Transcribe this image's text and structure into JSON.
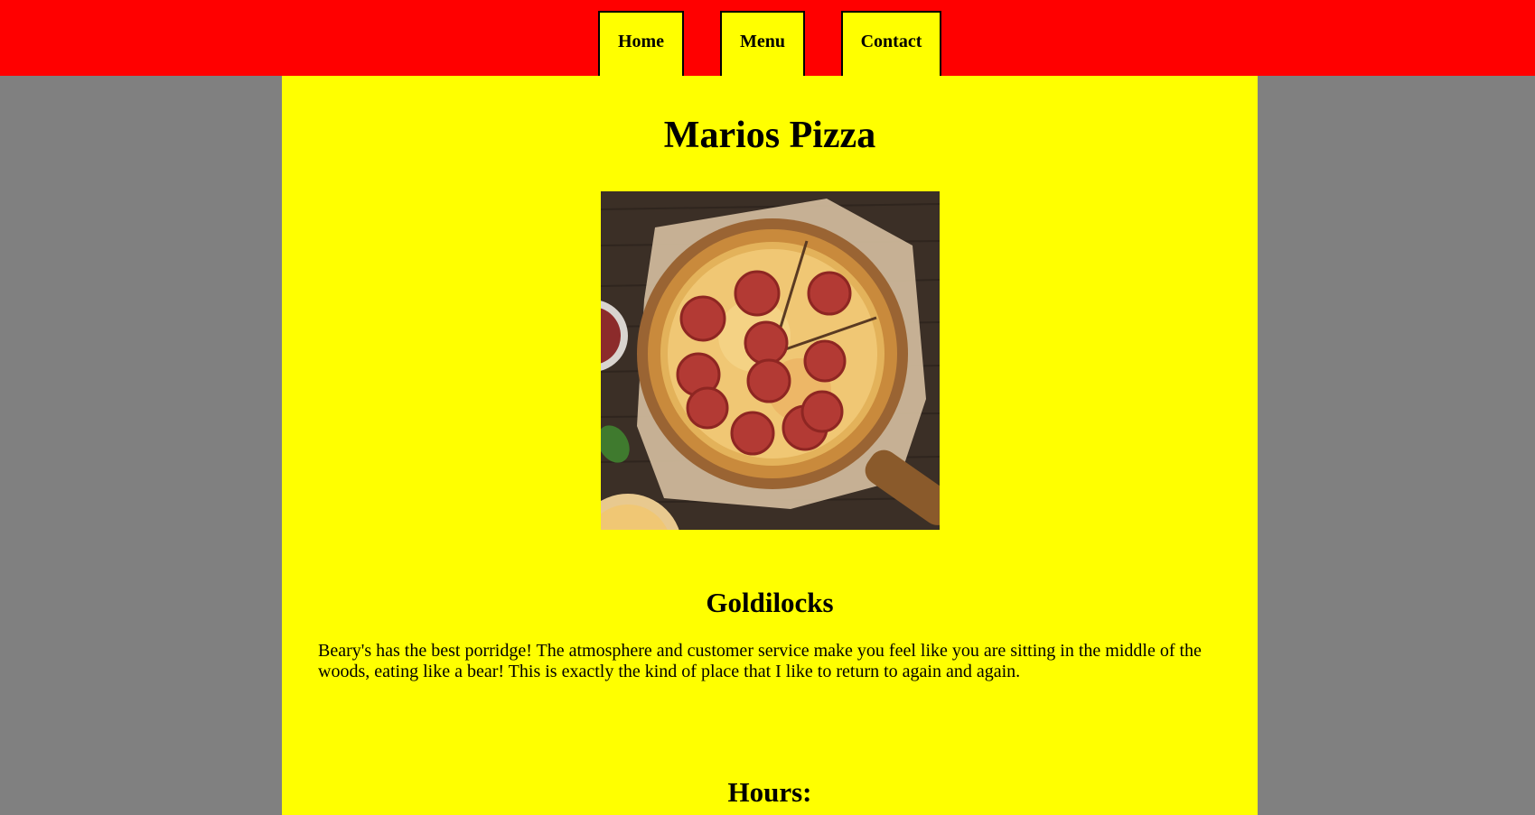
{
  "nav": {
    "home_label": "Home",
    "menu_label": "Menu",
    "contact_label": "Contact"
  },
  "main": {
    "title": "Marios Pizza",
    "image_icon": "pepperoni-pizza-photo",
    "review": {
      "author": "Goldilocks",
      "text": "Beary's has the best porridge! The atmosphere and customer service make you feel like you are sitting in the middle of the woods, eating like a bear! This is exactly the kind of place that I like to return to again and again."
    },
    "hours_heading": "Hours:"
  },
  "colors": {
    "header_bg": "#ff0000",
    "content_bg": "#ffff00",
    "page_bg": "#808080"
  }
}
